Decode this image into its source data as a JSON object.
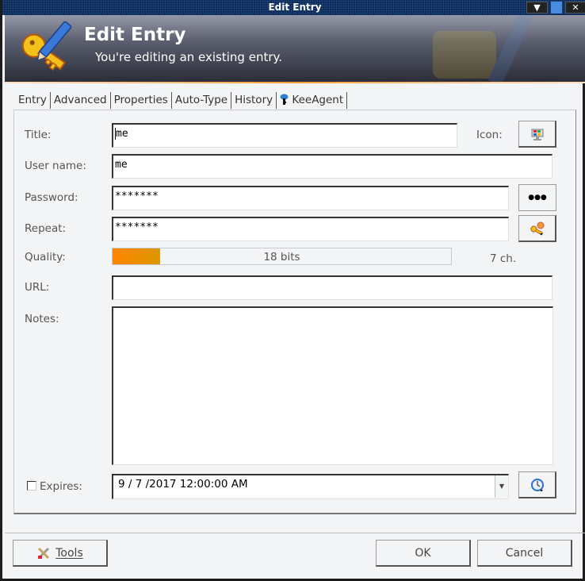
{
  "window": {
    "title": "Edit Entry",
    "controls": [
      "minimize-icon",
      "maximize-icon",
      "close-icon"
    ]
  },
  "banner": {
    "title": "Edit Entry",
    "subtitle": "You're editing an existing entry.",
    "icon": "key-pencil-icon"
  },
  "tabs": [
    {
      "label": "Entry",
      "active": true
    },
    {
      "label": "Advanced"
    },
    {
      "label": "Properties"
    },
    {
      "label": "Auto-Type"
    },
    {
      "label": "History"
    },
    {
      "label": "KeeAgent",
      "icon": "keeagent-icon"
    }
  ],
  "form": {
    "title_label": "Title:",
    "title_value": "me",
    "icon_label": "Icon:",
    "username_label": "User name:",
    "username_value": "me",
    "password_label": "Password:",
    "password_value": "*******",
    "show_password_glyph": "●●●",
    "repeat_label": "Repeat:",
    "repeat_value": "*******",
    "quality_label": "Quality:",
    "quality_text": "18 bits",
    "quality_fraction": 0.14,
    "char_count": "7 ch.",
    "url_label": "URL:",
    "url_value": "",
    "notes_label": "Notes:",
    "notes_value": "",
    "expires_label": "Expires:",
    "expires_checked": false,
    "expires_value": "9 / 7 /2017  12:00:00  AM"
  },
  "footer": {
    "tools_label": "Tools",
    "ok_label": "OK",
    "cancel_label": "Cancel"
  },
  "colors": {
    "quality_start": "#ff8600",
    "quality_end": "#dc9600",
    "titlebar": "#0e2a55"
  }
}
